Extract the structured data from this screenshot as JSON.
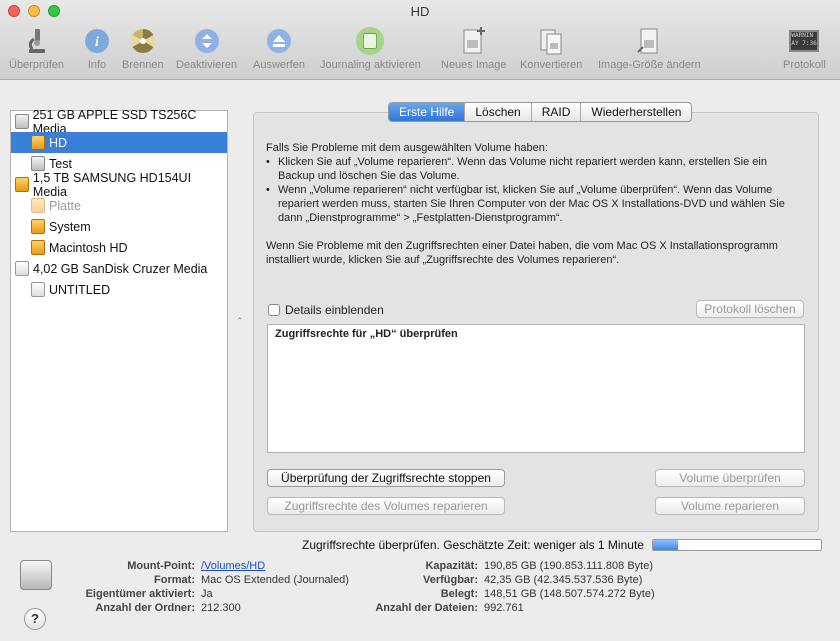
{
  "window": {
    "title": "HD"
  },
  "toolbar": [
    {
      "label": "Überprüfen",
      "icon": "microscope-icon"
    },
    {
      "label": "Info",
      "icon": "info-icon"
    },
    {
      "label": "Brennen",
      "icon": "burn-icon"
    },
    {
      "label": "Deaktivieren",
      "icon": "unmount-icon"
    },
    {
      "label": "Auswerfen",
      "icon": "eject-icon"
    },
    {
      "label": "Journaling aktivieren",
      "icon": "journal-icon"
    },
    {
      "label": "Neues Image",
      "icon": "new-image-icon"
    },
    {
      "label": "Konvertieren",
      "icon": "convert-icon"
    },
    {
      "label": "Image-Größe ändern",
      "icon": "resize-image-icon"
    },
    {
      "label": "Protokoll",
      "icon": "log-icon",
      "icon_text": "WARNIN\nAY 7:36"
    }
  ],
  "sidebar": {
    "items": [
      {
        "label": "251 GB APPLE SSD TS256C Media",
        "type": "disk"
      },
      {
        "label": "HD",
        "type": "volume",
        "selected": true
      },
      {
        "label": "Test",
        "type": "volume"
      },
      {
        "label": "1,5 TB SAMSUNG HD154UI Media",
        "type": "disk"
      },
      {
        "label": "Platte",
        "type": "volume",
        "dimmed": true
      },
      {
        "label": "System",
        "type": "volume"
      },
      {
        "label": "Macintosh HD",
        "type": "volume"
      },
      {
        "label": "4,02 GB SanDisk Cruzer Media",
        "type": "usb"
      },
      {
        "label": "UNTITLED",
        "type": "usb-volume"
      }
    ]
  },
  "tabs": [
    {
      "label": "Erste Hilfe",
      "active": true
    },
    {
      "label": "Löschen"
    },
    {
      "label": "RAID"
    },
    {
      "label": "Wiederherstellen"
    }
  ],
  "help": {
    "intro": "Falls Sie Probleme mit dem ausgewählten Volume haben:",
    "bullet1": "Klicken Sie auf „Volume reparieren“. Wenn das Volume nicht repariert werden kann, erstellen Sie ein Backup und löschen Sie das Volume.",
    "bullet2": "Wenn „Volume reparieren“ nicht verfügbar ist, klicken Sie auf „Volume überprüfen“. Wenn das Volume repariert werden muss, starten Sie Ihren Computer von der Mac OS X Installations-DVD und wählen Sie dann „Dienstprogramme“ > „Festplatten-Dienstprogramm“.",
    "permissions": "Wenn Sie Probleme mit den Zugriffsrechten einer Datei haben, die vom Mac OS X Installationsprogramm installiert wurde, klicken Sie auf „Zugriffsrechte des Volumes reparieren“."
  },
  "details_checkbox": "Details einblenden",
  "clear_log_button": "Protokoll löschen",
  "log_text": "Zugriffsrechte für „HD“ überprüfen",
  "buttons": {
    "stop_check": "Überprüfung der Zugriffsrechte stoppen",
    "verify_volume": "Volume überprüfen",
    "repair_permissions": "Zugriffsrechte des Volumes reparieren",
    "repair_volume": "Volume reparieren"
  },
  "status": {
    "text": "Zugriffsrechte überprüfen. Geschätzte Zeit: weniger als 1 Minute",
    "progress": 0.15
  },
  "info": {
    "mount_label": "Mount-Point:",
    "mount_value": "/Volumes/HD",
    "format_label": "Format:",
    "format_value": "Mac OS Extended (Journaled)",
    "owners_label": "Eigentümer aktiviert:",
    "owners_value": "Ja",
    "folders_label": "Anzahl der Ordner:",
    "folders_value": "212.300",
    "capacity_label": "Kapazität:",
    "capacity_value": "190,85 GB (190.853.111.808 Byte)",
    "available_label": "Verfügbar:",
    "available_value": "42,35 GB (42.345.537.536 Byte)",
    "used_label": "Belegt:",
    "used_value": "148,51 GB (148.507.574.272 Byte)",
    "files_label": "Anzahl der Dateien:",
    "files_value": "992.761"
  },
  "help_button": "?"
}
